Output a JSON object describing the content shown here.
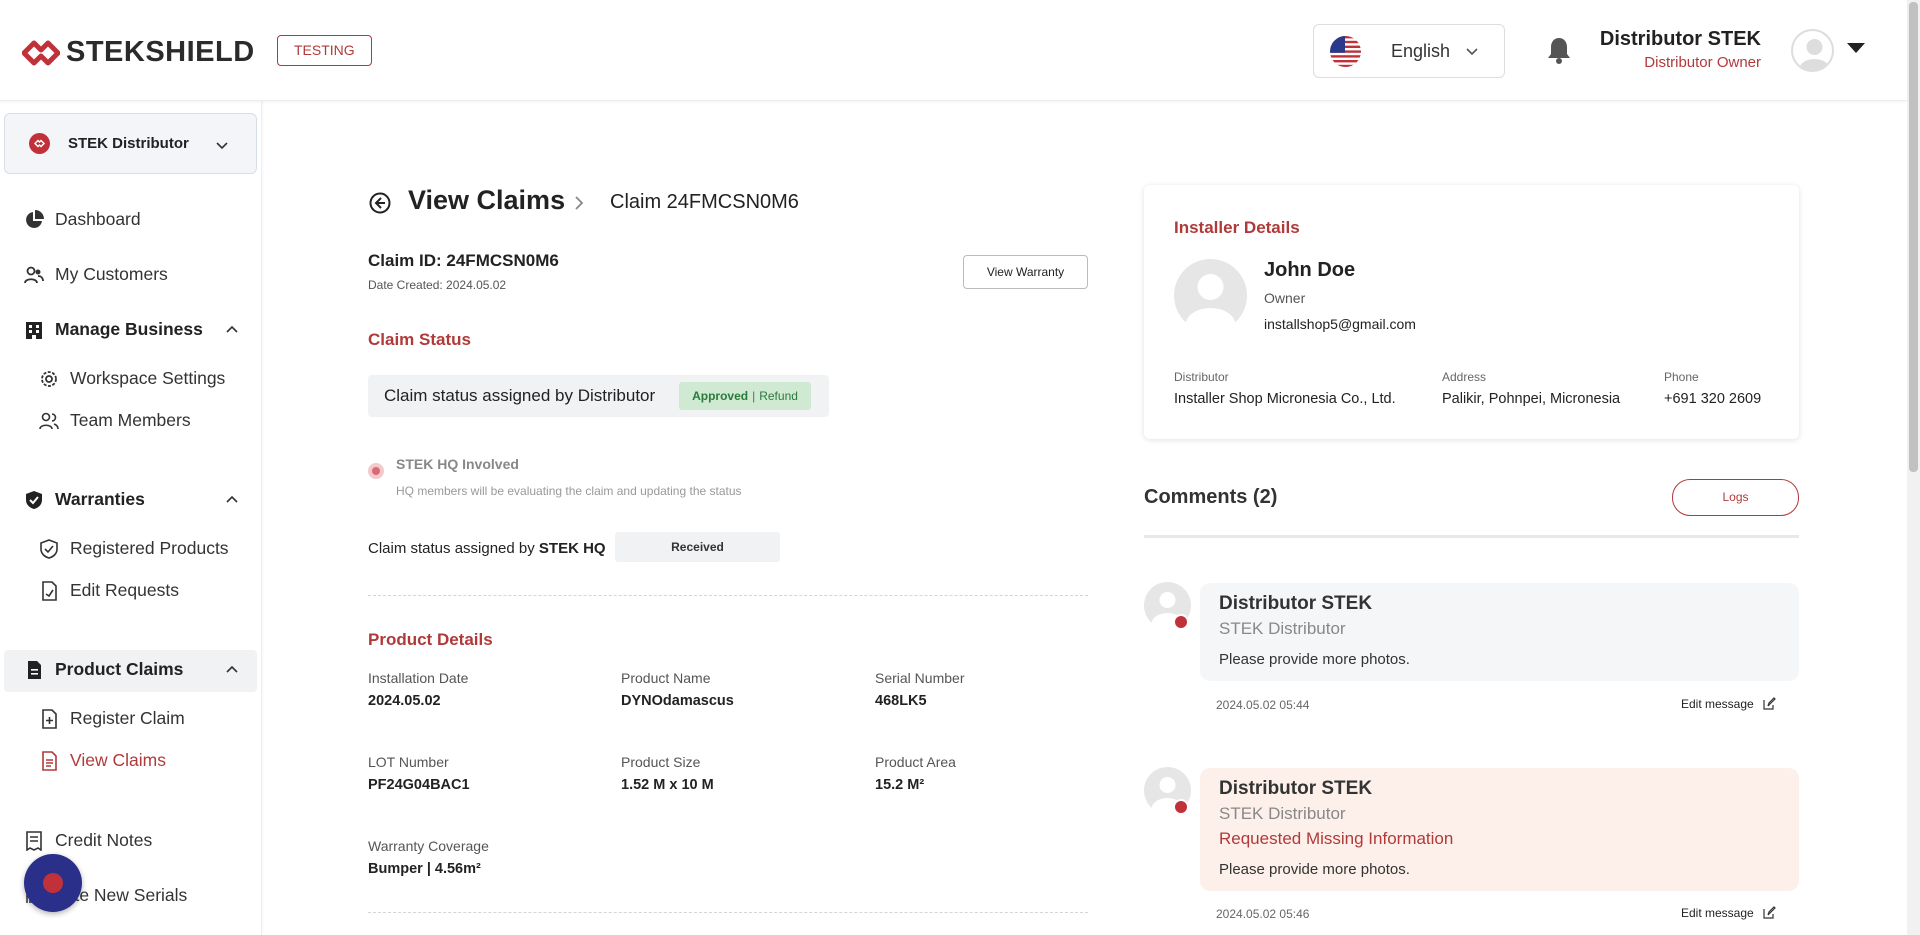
{
  "header": {
    "logo_text": "STEKSHIELD",
    "env_badge": "TESTING",
    "language": "English",
    "user_name": "Distributor STEK",
    "user_role": "Distributor Owner"
  },
  "sidebar": {
    "org_name": "STEK Distributor",
    "items": [
      {
        "label": "Dashboard",
        "icon": "pie-chart-icon"
      },
      {
        "label": "My Customers",
        "icon": "users-icon"
      },
      {
        "label": "Manage Business",
        "icon": "building-icon",
        "expanded": true
      },
      {
        "label": "Workspace Settings",
        "icon": "gear-icon"
      },
      {
        "label": "Team Members",
        "icon": "team-icon"
      },
      {
        "label": "Warranties",
        "icon": "shield-check-icon",
        "expanded": true
      },
      {
        "label": "Registered Products",
        "icon": "shield-icon"
      },
      {
        "label": "Edit Requests",
        "icon": "file-edit-icon"
      },
      {
        "label": "Product Claims",
        "icon": "document-icon",
        "expanded": true
      },
      {
        "label": "Register Claim",
        "icon": "file-plus-icon"
      },
      {
        "label": "View Claims",
        "icon": "file-list-icon",
        "active": true
      },
      {
        "label": "Credit Notes",
        "icon": "receipt-icon"
      },
      {
        "label": "Create New Serials",
        "visible_label": "eate New Serials",
        "icon": "barcode-icon"
      }
    ]
  },
  "page": {
    "title": "View Claims",
    "breadcrumb": "Claim 24FMCSN0M6",
    "claim_id": "Claim ID: 24FMCSN0M6",
    "date_created": "Date Created: 2024.05.02",
    "view_warranty_label": "View Warranty"
  },
  "claim_status": {
    "section_title": "Claim Status",
    "distributor_label": "Claim status assigned by Distributor",
    "approved": "Approved",
    "separator": "|",
    "refund": "Refund",
    "hq_title": "STEK HQ Involved",
    "hq_desc": "HQ members will be evaluating the claim and updating the status",
    "hq_assigned_prefix": "Claim status assigned by",
    "hq_assigned_by": "STEK HQ",
    "hq_status": "Received"
  },
  "product_details": {
    "section_title": "Product Details",
    "fields": [
      {
        "label": "Installation Date",
        "value": "2024.05.02"
      },
      {
        "label": "Product Name",
        "value": "DYNOdamascus"
      },
      {
        "label": "Serial Number",
        "value": "468LK5"
      },
      {
        "label": "LOT Number",
        "value": "PF24G04BAC1"
      },
      {
        "label": "Product Size",
        "value": "1.52 M x 10 M"
      },
      {
        "label": "Product Area",
        "value": "15.2 M²"
      },
      {
        "label": "Warranty Coverage",
        "value": "Bumper | 4.56m²"
      }
    ]
  },
  "installer": {
    "section_title": "Installer Details",
    "name": "John Doe",
    "role": "Owner",
    "email": "installshop5@gmail.com",
    "distributor_label": "Distributor",
    "distributor": "Installer Shop Micronesia Co., Ltd.",
    "address_label": "Address",
    "address": "Palikir, Pohnpei, Micronesia",
    "phone_label": "Phone",
    "phone": "+691 320 2609"
  },
  "comments": {
    "title": "Comments (2)",
    "logs_label": "Logs",
    "edit_label": "Edit message",
    "items": [
      {
        "author": "Distributor STEK",
        "org": "STEK Distributor",
        "flag": "",
        "text": "Please provide more photos.",
        "time": "2024.05.02 05:44"
      },
      {
        "author": "Distributor STEK",
        "org": "STEK Distributor",
        "flag": "Requested Missing Information",
        "text": "Please provide more photos.",
        "time": "2024.05.02 05:46"
      }
    ]
  },
  "colors": {
    "accent": "#b03a3a",
    "brand_red": "#c0313a",
    "approved_bg": "#cfe9d2",
    "approved_text": "#2a7a3a",
    "highlight_comment_bg": "#fdf0ea",
    "comment_bg": "#f5f6f8",
    "fab": "#2a2f8a"
  }
}
